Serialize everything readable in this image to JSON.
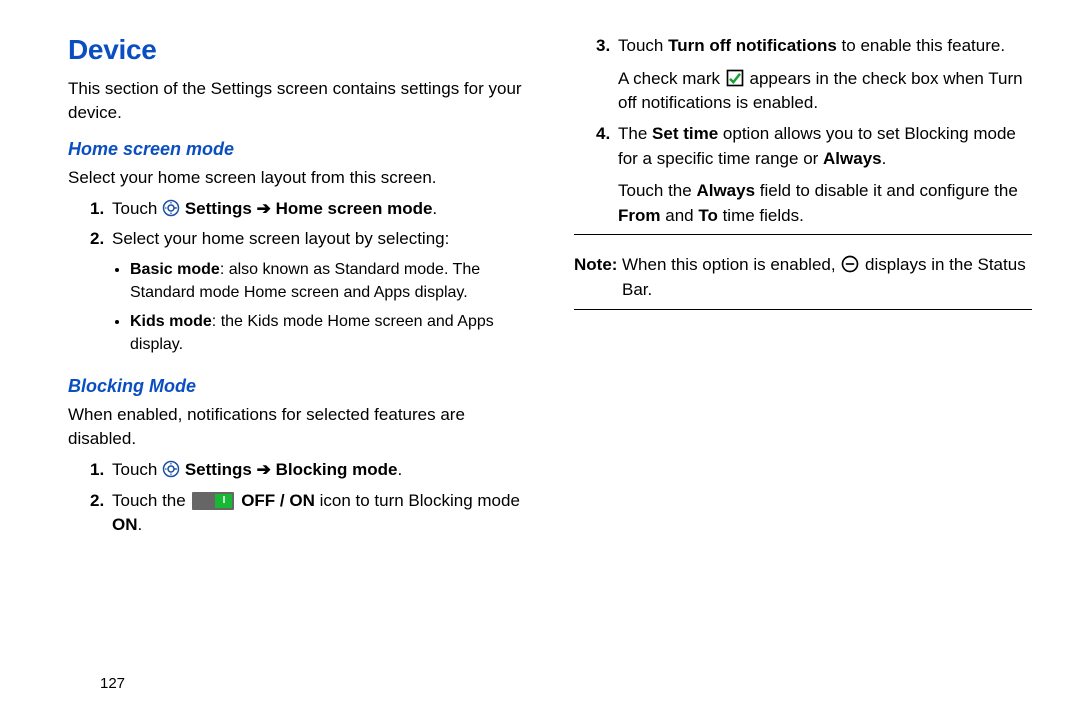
{
  "title": "Device",
  "intro": "This section of the Settings screen contains settings for your device.",
  "home": {
    "heading": "Home screen mode",
    "intro": "Select your home screen layout from this screen.",
    "step1_prefix": "Touch ",
    "step1_suffix": "Settings ➔ Home screen mode",
    "step2_intro": "Select your home screen layout by selecting:",
    "bullet1_label": "Basic mode",
    "bullet1_rest": ": also known as Standard mode. The Standard mode Home screen and Apps display.",
    "bullet2_label": "Kids mode",
    "bullet2_rest": ": the Kids mode Home screen and Apps display."
  },
  "blocking": {
    "heading": "Blocking Mode",
    "intro": "When enabled, notifications for selected features are disabled.",
    "step1_prefix": "Touch ",
    "step1_suffix": "Settings ➔ Blocking mode",
    "step2_a": "Touch the ",
    "step2_b": "OFF / ON",
    "step2_c": " icon to turn Blocking mode ",
    "step2_d": "ON",
    "step2_e": "."
  },
  "right": {
    "s3_a": "Touch ",
    "s3_b": "Turn off notifications",
    "s3_c": " to enable this feature.",
    "s3_cont_a": "A check mark ",
    "s3_cont_b": " appears in the check box when Turn off notifications is enabled.",
    "s4_a": "The ",
    "s4_b": "Set time",
    "s4_c": " option allows you to set Blocking mode for a specific time range or ",
    "s4_d": "Always",
    "s4_e": ".",
    "s4_cont_a": "Touch the ",
    "s4_cont_b": "Always",
    "s4_cont_c": " field to disable it and configure the ",
    "s4_cont_d": "From",
    "s4_cont_e": " and ",
    "s4_cont_f": "To",
    "s4_cont_g": " time fields."
  },
  "note": {
    "label": "Note:",
    "a": "When this option is enabled, ",
    "b": " displays in the ",
    "c": "Status Bar."
  },
  "page_number": "127"
}
